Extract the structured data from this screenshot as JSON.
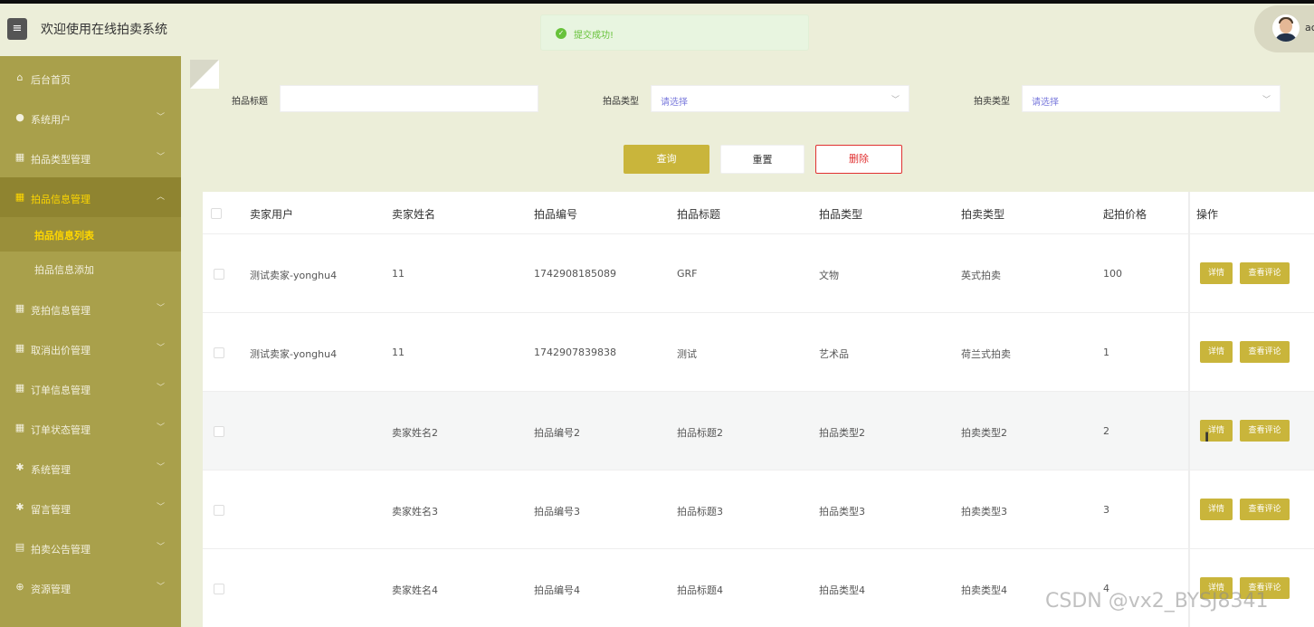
{
  "header": {
    "menu_icon": "hamburger-icon",
    "title": "欢迎使用在线拍卖系统",
    "user_name": "ac"
  },
  "toast": {
    "icon": "check-circle-icon",
    "message": "提交成功!",
    "color": "#67c23a"
  },
  "sidebar": {
    "items": [
      {
        "icon": "home-icon",
        "label": "后台首页"
      },
      {
        "icon": "user-icon",
        "label": "系统用户"
      },
      {
        "icon": "grid-icon",
        "label": "拍品类型管理"
      },
      {
        "icon": "grid-icon",
        "label": "拍品信息管理"
      },
      {
        "icon": "grid-icon",
        "label": "竞拍信息管理"
      },
      {
        "icon": "grid-icon",
        "label": "取消出价管理"
      },
      {
        "icon": "grid-icon",
        "label": "订单信息管理"
      },
      {
        "icon": "grid-icon",
        "label": "订单状态管理"
      },
      {
        "icon": "gear-icon",
        "label": "系统管理"
      },
      {
        "icon": "gear-icon",
        "label": "留言管理"
      },
      {
        "icon": "document-icon",
        "label": "拍卖公告管理"
      },
      {
        "icon": "plus-circle-icon",
        "label": "资源管理"
      }
    ],
    "sub_items": [
      {
        "label": "拍品信息列表"
      },
      {
        "label": "拍品信息添加"
      }
    ],
    "active_color": "#ffd700",
    "bg_color": "#a9a04b"
  },
  "filters": {
    "title_label": "拍品标题",
    "title_value": "",
    "type_label": "拍品类型",
    "type_placeholder": "请选择",
    "auction_type_label": "拍卖类型",
    "auction_type_placeholder": "请选择"
  },
  "actions": {
    "query": "查询",
    "reset": "重置",
    "delete": "删除"
  },
  "table": {
    "columns": [
      "卖家用户",
      "卖家姓名",
      "拍品编号",
      "拍品标题",
      "拍品类型",
      "拍卖类型",
      "起拍价格",
      "操作"
    ],
    "rows": [
      {
        "seller_user": "测试卖家-yonghu4",
        "seller_name": "11",
        "item_no": "1742908185089",
        "item_title": "GRF",
        "item_type": "文物",
        "auction_type": "英式拍卖",
        "start_price": "100"
      },
      {
        "seller_user": "测试卖家-yonghu4",
        "seller_name": "11",
        "item_no": "1742907839838",
        "item_title": "测试",
        "item_type": "艺术品",
        "auction_type": "荷兰式拍卖",
        "start_price": "1"
      },
      {
        "seller_user": "",
        "seller_name": "卖家姓名2",
        "item_no": "拍品编号2",
        "item_title": "拍品标题2",
        "item_type": "拍品类型2",
        "auction_type": "拍卖类型2",
        "start_price": "2"
      },
      {
        "seller_user": "",
        "seller_name": "卖家姓名3",
        "item_no": "拍品编号3",
        "item_title": "拍品标题3",
        "item_type": "拍品类型3",
        "auction_type": "拍卖类型3",
        "start_price": "3"
      },
      {
        "seller_user": "",
        "seller_name": "卖家姓名4",
        "item_no": "拍品编号4",
        "item_title": "拍品标题4",
        "item_type": "拍品类型4",
        "auction_type": "拍卖类型4",
        "start_price": "4"
      }
    ],
    "detail_label": "详情",
    "review_label": "查看评论"
  },
  "watermark": "CSDN @vx2_BYSJ8341",
  "colors": {
    "accent": "#c9b53b",
    "danger": "#e03030",
    "background": "#eceed9"
  }
}
